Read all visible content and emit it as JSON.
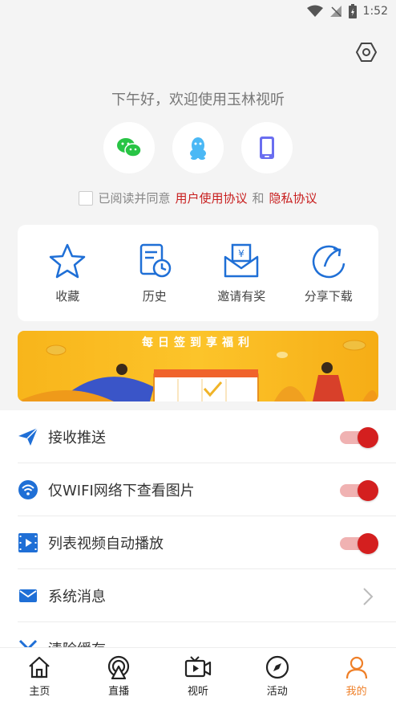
{
  "status": {
    "time": "1:52"
  },
  "greeting": "下午好，欢迎使用玉林视听",
  "login": {
    "options": [
      "wechat",
      "qq",
      "phone"
    ]
  },
  "agreement": {
    "prefix": "已阅读并同意",
    "user_agreement": "用户使用协议",
    "and": "和",
    "privacy": "隐私协议",
    "checked": false
  },
  "quick_actions": [
    {
      "label": "收藏",
      "icon": "star-icon"
    },
    {
      "label": "历史",
      "icon": "history-icon"
    },
    {
      "label": "邀请有奖",
      "icon": "invite-reward-icon"
    },
    {
      "label": "分享下载",
      "icon": "share-icon"
    }
  ],
  "banner": {
    "title": "每日签到享福利"
  },
  "settings": [
    {
      "label": "接收推送",
      "type": "toggle",
      "on": true
    },
    {
      "label": "仅WIFI网络下查看图片",
      "type": "toggle",
      "on": true
    },
    {
      "label": "列表视频自动播放",
      "type": "toggle",
      "on": true
    },
    {
      "label": "系统消息",
      "type": "link"
    },
    {
      "label": "清除缓存",
      "type": "link"
    }
  ],
  "tabs": [
    {
      "label": "主页",
      "active": false
    },
    {
      "label": "直播",
      "active": false
    },
    {
      "label": "视听",
      "active": false
    },
    {
      "label": "活动",
      "active": false
    },
    {
      "label": "我的",
      "active": true
    }
  ],
  "colors": {
    "accent_red": "#d41f1f",
    "tab_active": "#ef7f27",
    "icon_blue": "#1f6fd6"
  }
}
